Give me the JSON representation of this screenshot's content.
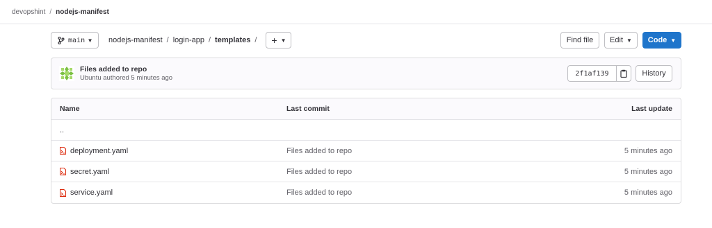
{
  "top_breadcrumb": {
    "group": "devopshint",
    "project": "nodejs-manifest"
  },
  "toolbar": {
    "branch": "main",
    "path": [
      "nodejs-manifest",
      "login-app",
      "templates"
    ],
    "find_file": "Find file",
    "edit": "Edit",
    "code": "Code"
  },
  "commit": {
    "title": "Files added to repo",
    "meta": "Ubuntu authored 5 minutes ago",
    "sha": "2f1af139",
    "history": "History"
  },
  "table": {
    "headers": {
      "name": "Name",
      "last_commit": "Last commit",
      "last_update": "Last update"
    },
    "parent": "..",
    "rows": [
      {
        "name": "deployment.yaml",
        "commit": "Files added to repo",
        "updated": "5 minutes ago"
      },
      {
        "name": "secret.yaml",
        "commit": "Files added to repo",
        "updated": "5 minutes ago"
      },
      {
        "name": "service.yaml",
        "commit": "Files added to repo",
        "updated": "5 minutes ago"
      }
    ]
  },
  "colors": {
    "primary": "#1f75cb",
    "file_icon": "#dd2b0e",
    "avatar": "#7bc043"
  }
}
